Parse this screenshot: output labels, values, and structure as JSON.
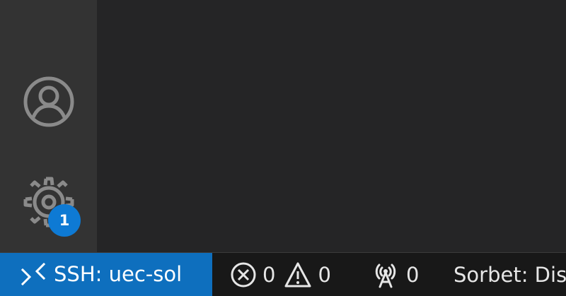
{
  "activity_bar": {
    "accounts_icon": "account-icon",
    "manage_icon": "gear-icon",
    "manage_badge": "1",
    "badge_color": "#0e7ad4"
  },
  "status_bar": {
    "remote": {
      "icon": "remote-icon",
      "label": "SSH: uec-sol",
      "background": "#0e6fbe"
    },
    "problems": {
      "error_icon": "error-icon",
      "errors": "0",
      "warning_icon": "warning-icon",
      "warnings": "0"
    },
    "ports": {
      "icon": "radio-tower-icon",
      "count": "0"
    },
    "sorbet_label": "Sorbet: Dis"
  },
  "colors": {
    "activity_bar": "#333333",
    "editor": "#252526",
    "status_bar": "#181818",
    "foreground": "#e6e6e6"
  }
}
